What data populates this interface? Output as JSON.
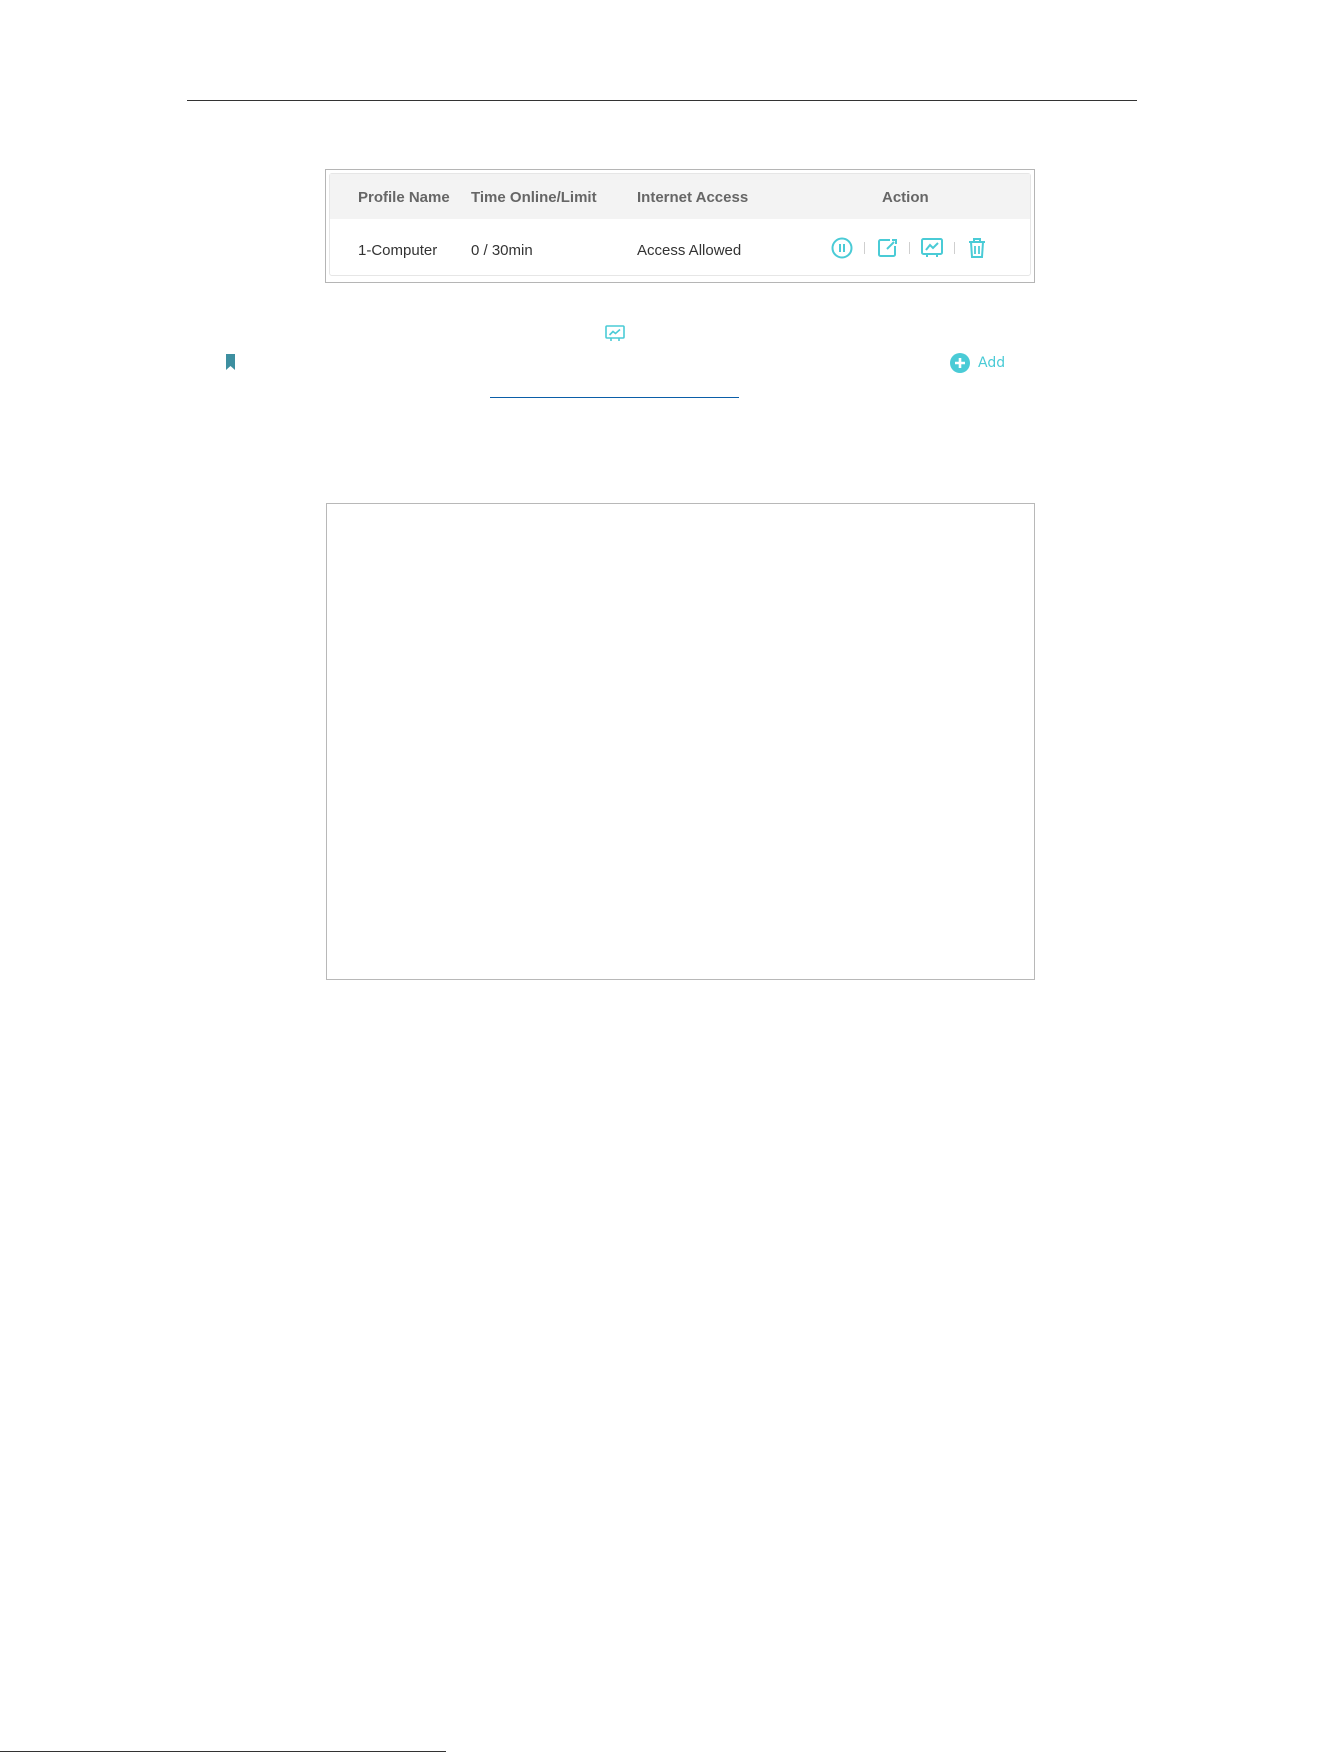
{
  "table": {
    "headers": [
      "Profile Name",
      "Time Online/Limit",
      "Internet Access",
      "Action"
    ],
    "rows": [
      {
        "profile_name": "1-Computer",
        "time_online_limit": "0 / 30min",
        "internet_access": "Access Allowed"
      }
    ],
    "action_icons": [
      "pause-icon",
      "edit-icon",
      "insights-chart-icon",
      "trash-icon"
    ]
  },
  "add_button": {
    "label": "Add",
    "icon": "plus-circle-icon"
  },
  "colors": {
    "accent": "#4acbd6",
    "bookmark": "#3d8fa0",
    "link": "#0b5ea8"
  }
}
